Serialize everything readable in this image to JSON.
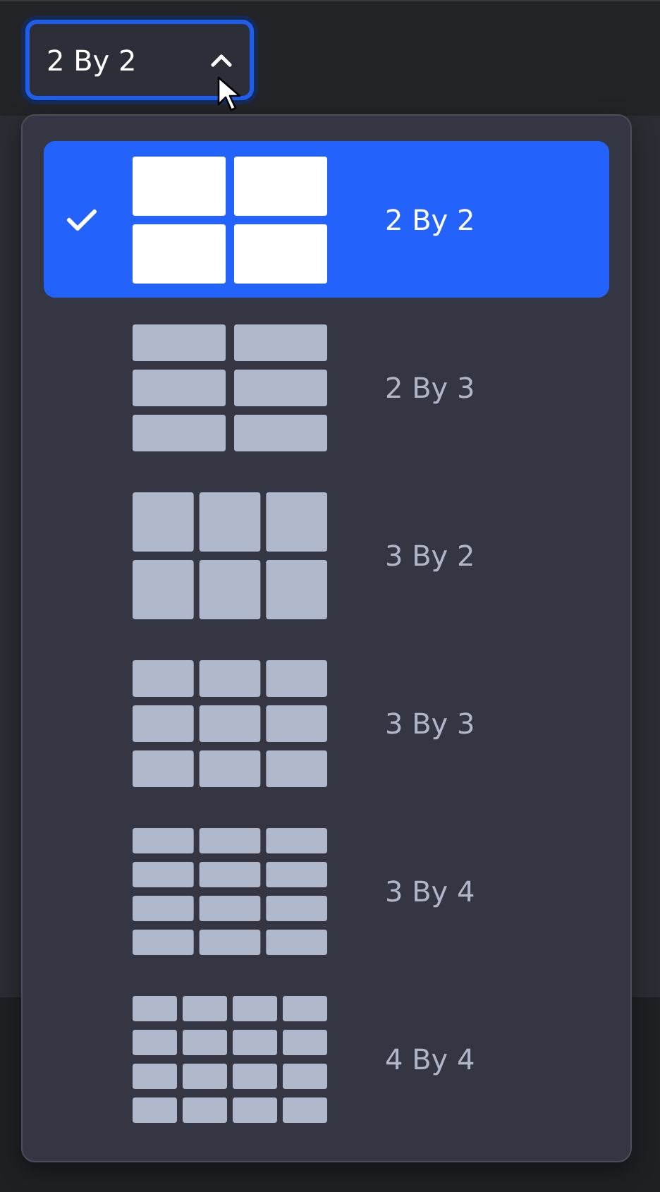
{
  "layout_button": {
    "label": "2 By 2",
    "expanded": true
  },
  "options": [
    {
      "label": "2 By 2",
      "kind": "quad",
      "selected": true
    },
    {
      "label": "2 By 3",
      "kind": "sixrows",
      "selected": false
    },
    {
      "label": "3 By 2",
      "kind": "sixcols",
      "selected": false
    },
    {
      "label": "3 By 3",
      "kind": "nine",
      "selected": false
    },
    {
      "label": "3 By 4",
      "kind": "twelve",
      "selected": false
    },
    {
      "label": "4 By 4",
      "kind": "sixteen",
      "selected": false
    }
  ]
}
